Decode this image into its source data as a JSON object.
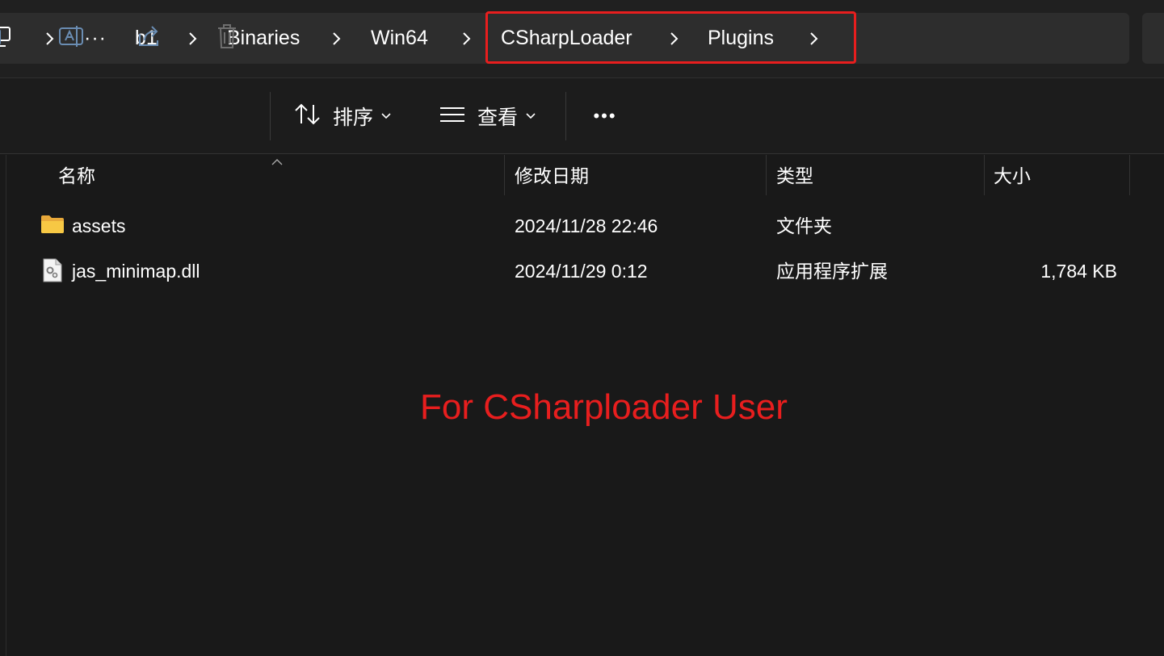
{
  "breadcrumb": {
    "items": [
      "···",
      "b1",
      "Binaries",
      "Win64",
      "CSharpLoader",
      "Plugins"
    ]
  },
  "toolbar": {
    "sort_label": "排序",
    "view_label": "查看",
    "more_label": "•••"
  },
  "columns": {
    "name": "名称",
    "modified": "修改日期",
    "type": "类型",
    "size": "大小"
  },
  "files": [
    {
      "name": "assets",
      "modified": "2024/11/28 22:46",
      "type": "文件夹",
      "size": "",
      "icon": "folder-icon"
    },
    {
      "name": "jas_minimap.dll",
      "modified": "2024/11/29 0:12",
      "type": "应用程序扩展",
      "size": "1,784 KB",
      "icon": "dll-file-icon"
    }
  ],
  "annotation": "For CSharploader User",
  "colors": {
    "background": "#191919",
    "highlight": "#e81e1e",
    "folder": "#f7c844"
  }
}
